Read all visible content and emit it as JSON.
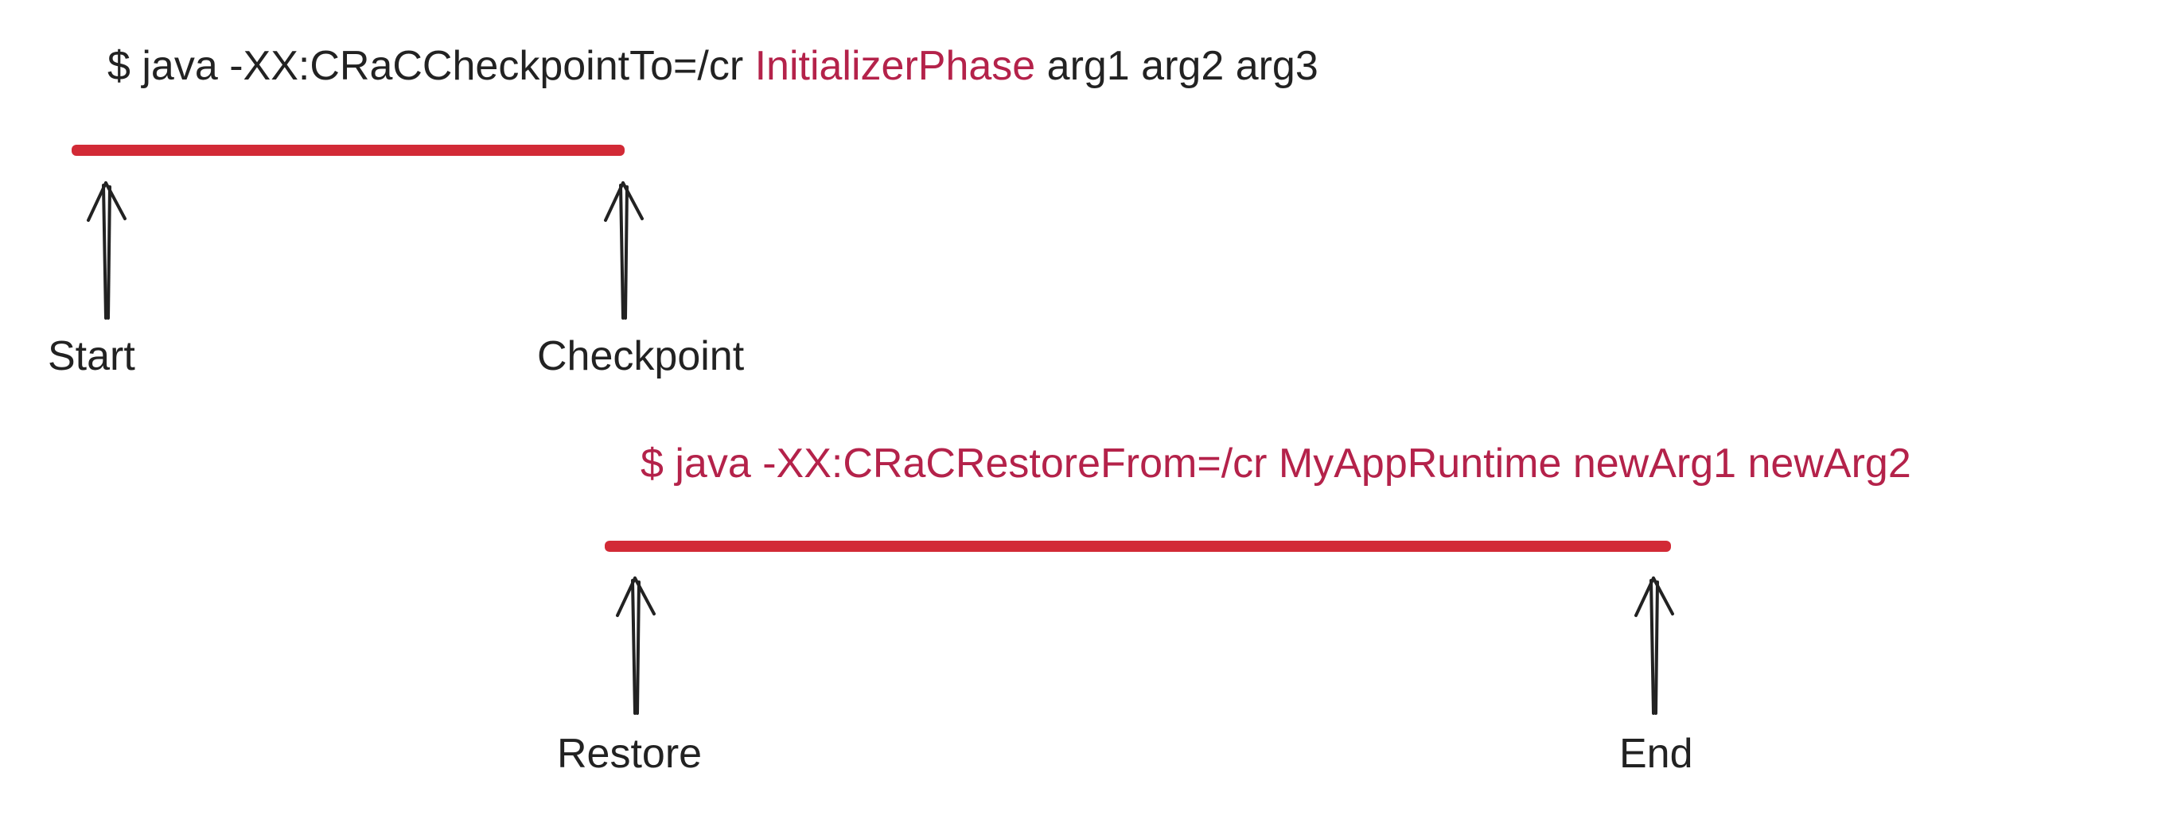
{
  "colors": {
    "highlight": "#b4224a",
    "bar": "#d22a36",
    "text": "#222222"
  },
  "top_command": {
    "prompt": "$ ",
    "part_java": "java ",
    "part_flag": "-XX:CRaCCheckpointTo=/cr ",
    "part_class": "InitializerPhase",
    "part_args": " arg1 arg2 arg3"
  },
  "bottom_command": {
    "prompt": "$ ",
    "part_java": "java ",
    "part_flag": "-XX:CRaCRestoreFrom=/cr ",
    "part_class": "MyAppRuntime",
    "part_args": " newArg1 newArg2"
  },
  "labels": {
    "start": "Start",
    "checkpoint": "Checkpoint",
    "restore": "Restore",
    "end": "End"
  }
}
